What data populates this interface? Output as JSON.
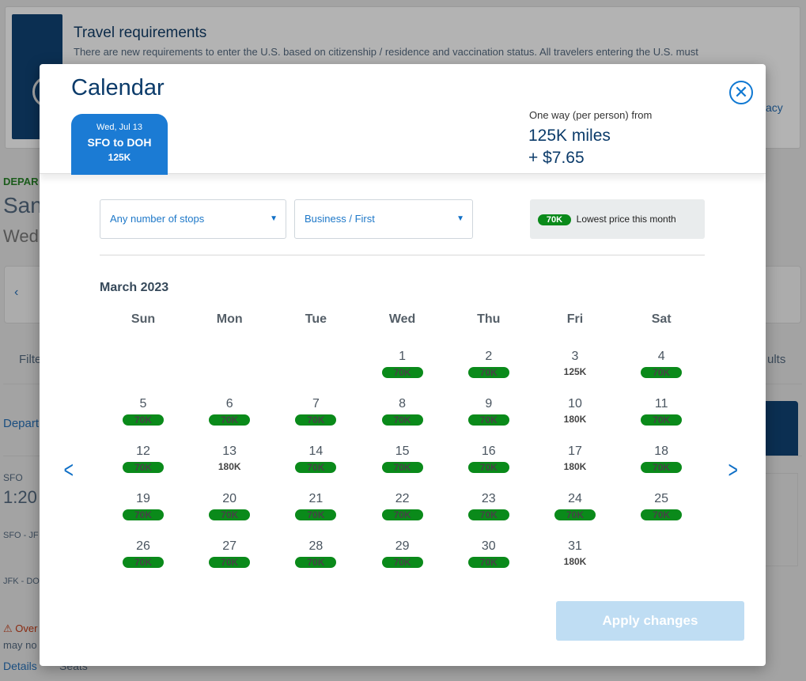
{
  "background": {
    "travel_title": "Travel requirements",
    "travel_text": "There are new requirements to enter the U.S. based on citizenship / residence and vaccination status. All travelers entering the U.S. must",
    "privacy_fragment": "acy",
    "depart_label": "DEPAR",
    "city_fragment": "San",
    "date_fragment": "Wed",
    "filter_fragment": "Filte",
    "results_fragment": "ults",
    "depart_fragment": "Depart",
    "origin": "SFO",
    "time_fragment": "1:20",
    "leg1": "SFO - JF",
    "leg2": "JFK - DO",
    "warning_fragment": "Over",
    "warning_fragment2": "may no",
    "details": "Details",
    "seats": "Seats"
  },
  "modal": {
    "title": "Calendar",
    "close_icon": "close-circle-icon",
    "segment": {
      "date": "Wed, Jul 13",
      "route": "SFO to DOH",
      "price": "125K"
    },
    "fare": {
      "label": "One way (per person) from",
      "miles": "125K miles",
      "tax": "+ $7.65"
    },
    "stops_select": "Any number of stops",
    "cabin_select": "Business / First",
    "lowest": {
      "badge": "70K",
      "label": "Lowest price this month"
    },
    "month": "March 2023",
    "weekdays": [
      "Sun",
      "Mon",
      "Tue",
      "Wed",
      "Thu",
      "Fri",
      "Sat"
    ],
    "first_weekday_index": 3,
    "lowest_color": "#0a8a1a",
    "days": [
      {
        "d": "1",
        "p": "70K",
        "low": true
      },
      {
        "d": "2",
        "p": "70K",
        "low": true
      },
      {
        "d": "3",
        "p": "125K",
        "low": false
      },
      {
        "d": "4",
        "p": "70K",
        "low": true
      },
      {
        "d": "5",
        "p": "70K",
        "low": true
      },
      {
        "d": "6",
        "p": "70K",
        "low": true
      },
      {
        "d": "7",
        "p": "70K",
        "low": true
      },
      {
        "d": "8",
        "p": "70K",
        "low": true
      },
      {
        "d": "9",
        "p": "70K",
        "low": true
      },
      {
        "d": "10",
        "p": "180K",
        "low": false
      },
      {
        "d": "11",
        "p": "70K",
        "low": true
      },
      {
        "d": "12",
        "p": "70K",
        "low": true
      },
      {
        "d": "13",
        "p": "180K",
        "low": false
      },
      {
        "d": "14",
        "p": "70K",
        "low": true
      },
      {
        "d": "15",
        "p": "70K",
        "low": true
      },
      {
        "d": "16",
        "p": "70K",
        "low": true
      },
      {
        "d": "17",
        "p": "180K",
        "low": false
      },
      {
        "d": "18",
        "p": "70K",
        "low": true
      },
      {
        "d": "19",
        "p": "70K",
        "low": true
      },
      {
        "d": "20",
        "p": "70K",
        "low": true
      },
      {
        "d": "21",
        "p": "70K",
        "low": true
      },
      {
        "d": "22",
        "p": "70K",
        "low": true
      },
      {
        "d": "23",
        "p": "70K",
        "low": true
      },
      {
        "d": "24",
        "p": "70K",
        "low": true
      },
      {
        "d": "25",
        "p": "70K",
        "low": true
      },
      {
        "d": "26",
        "p": "70K",
        "low": true
      },
      {
        "d": "27",
        "p": "70K",
        "low": true
      },
      {
        "d": "28",
        "p": "70K",
        "low": true
      },
      {
        "d": "29",
        "p": "70K",
        "low": true
      },
      {
        "d": "30",
        "p": "70K",
        "low": true
      },
      {
        "d": "31",
        "p": "180K",
        "low": false
      }
    ],
    "prev_icon": "chevron-left-icon",
    "next_icon": "chevron-right-icon",
    "apply": "Apply changes"
  }
}
